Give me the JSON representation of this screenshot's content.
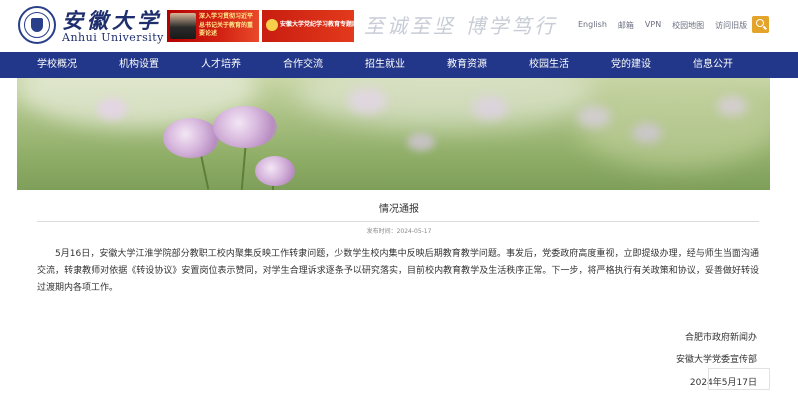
{
  "header": {
    "logo_cn": "安徽大学",
    "logo_en": "Anhui University",
    "banner1_text": "深入学习贯彻习近平总书记关于教育的重要论述",
    "banner2_text": "安徽大学党纪学习教育专题网",
    "motto": "至诚至坚 博学笃行",
    "links": [
      "English",
      "邮箱",
      "VPN",
      "校园地图",
      "访问旧版"
    ]
  },
  "nav": {
    "items": [
      "学校概况",
      "机构设置",
      "人才培养",
      "合作交流",
      "招生就业",
      "教育资源",
      "校园生活",
      "党的建设",
      "信息公开"
    ]
  },
  "article": {
    "title": "情况通报",
    "pubdate": "发布时间：2024-05-17",
    "body": "5月16日，安徽大学江淮学院部分教职工校内聚集反映工作转隶问题，少数学生校内集中反映后期教育教学问题。事发后，党委政府高度重视，立即提级办理，经与师生当面沟通交流，转隶教师对依据《转设协议》安置岗位表示赞同，对学生合理诉求逐条予以研究落实，目前校内教育教学及生活秩序正常。下一步，将严格执行有关政策和协议，妥善做好转设过渡期内各项工作。",
    "sign1": "合肥市政府新闻办",
    "sign2": "安徽大学党委宣传部",
    "sign_date": "2024年5月17日"
  },
  "colors": {
    "nav_bg": "#22378a",
    "brand": "#1f2f6e",
    "search_btn": "#e4a32a",
    "banner_red": "#d42314"
  },
  "icons": {
    "search": "search-icon",
    "seal": "university-seal-icon"
  }
}
